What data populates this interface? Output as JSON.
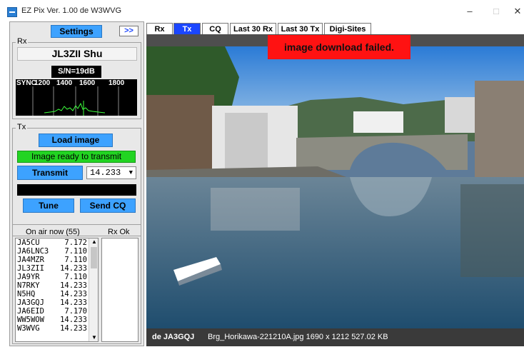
{
  "window": {
    "title": "EZ Pix   Ver. 1.00 de W3WVG",
    "minimize": "–",
    "maximize": "□",
    "close": "✕"
  },
  "rx": {
    "group_label": "Rx",
    "settings_label": "Settings",
    "expand_label": ">>",
    "callsign_display": "JL3ZII  Shu",
    "snr": "S/N=19dB",
    "spectrum_labels": [
      "SYNC",
      "1200",
      "1400",
      "1600",
      "1800"
    ]
  },
  "tx": {
    "group_label": "Tx",
    "load_image_label": "Load image",
    "status": "Image ready to transmit",
    "transmit_label": "Transmit",
    "frequency": "14.233",
    "tune_label": "Tune",
    "send_cq_label": "Send CQ"
  },
  "on_air": {
    "header_left": "On air now (55)",
    "header_right": "Rx Ok",
    "stations": [
      {
        "call": "JA5CU",
        "freq": "7.172"
      },
      {
        "call": "JA6LNC3",
        "freq": "7.110"
      },
      {
        "call": "JA4MZR",
        "freq": "7.110"
      },
      {
        "call": "JL3ZII",
        "freq": "14.233"
      },
      {
        "call": "JA9YR",
        "freq": "7.110"
      },
      {
        "call": "N7RKY",
        "freq": "14.233"
      },
      {
        "call": "N5HQ",
        "freq": "14.233"
      },
      {
        "call": "JA3GQJ",
        "freq": "14.233"
      },
      {
        "call": "JA6EID",
        "freq": "7.170"
      },
      {
        "call": "WW5WOW",
        "freq": "14.233"
      },
      {
        "call": "W3WVG",
        "freq": "14.233"
      }
    ]
  },
  "tabs": [
    {
      "label": "Rx",
      "active": false
    },
    {
      "label": "Tx",
      "active": true
    },
    {
      "label": "CQ",
      "active": false
    },
    {
      "label": "Last 30 Rx",
      "active": false
    },
    {
      "label": "Last 30 Tx",
      "active": false
    },
    {
      "label": "Digi-Sites",
      "active": false
    }
  ],
  "image_view": {
    "error": "image download failed.",
    "footer_sender": "de JA3GQJ",
    "footer_file": "Brg_Horikawa-221210A.jpg  1690 x 1212  527.02 KB"
  },
  "colors": {
    "accent_blue": "#3da2ff",
    "active_tab": "#1b46ff",
    "status_green": "#22d422",
    "error_red": "#ff1212"
  }
}
